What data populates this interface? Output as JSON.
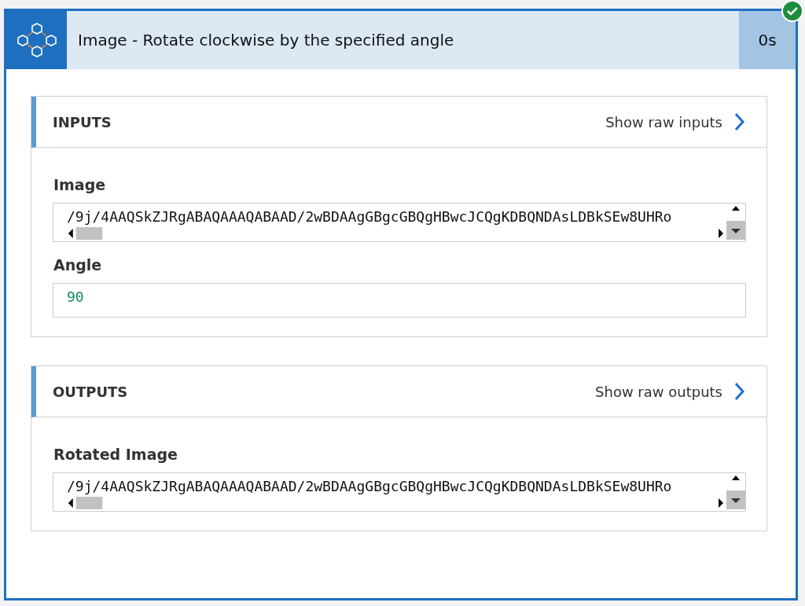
{
  "step": {
    "title": "Image - Rotate clockwise by the specified angle",
    "duration": "0s",
    "succeeded": true
  },
  "sections": [
    {
      "heading": "INPUTS",
      "raw_link": "Show raw inputs",
      "fields": [
        {
          "label": "Image",
          "kind": "long",
          "value": "/9j/4AAQSkZJRgABAQAAAQABAAD/2wBDAAgGBgcGBQgHBwcJCQgKDBQNDAsLDBkSEw8UHRo"
        },
        {
          "label": "Angle",
          "kind": "number",
          "value": "90"
        }
      ]
    },
    {
      "heading": "OUTPUTS",
      "raw_link": "Show raw outputs",
      "fields": [
        {
          "label": "Rotated Image",
          "kind": "long",
          "value": "/9j/4AAQSkZJRgABAQAAAQABAAD/2wBDAAgGBgcGBQgHBwcJCQgKDBQNDAsLDBkSEw8UHRo"
        }
      ]
    }
  ]
}
